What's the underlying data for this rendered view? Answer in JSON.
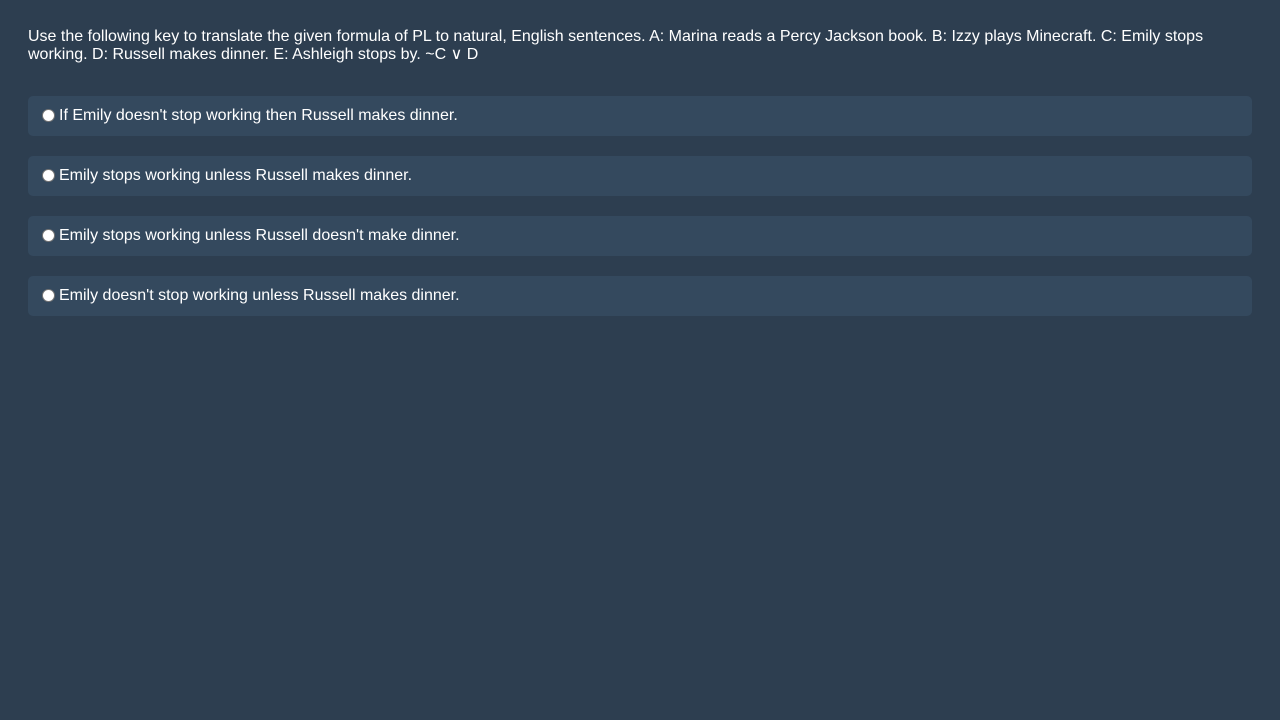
{
  "question": {
    "text": "Use the following key to translate the given formula of PL to natural, English sentences. A: Marina reads a Percy Jackson book. B: Izzy plays Minecraft. C: Emily stops working. D: Russell makes dinner. E: Ashleigh stops by. ~C ∨ D"
  },
  "options": [
    {
      "label": "If Emily doesn't stop working then Russell makes dinner."
    },
    {
      "label": "Emily stops working unless Russell makes dinner."
    },
    {
      "label": "Emily stops working unless Russell doesn't make dinner."
    },
    {
      "label": "Emily doesn't stop working unless Russell makes dinner."
    }
  ],
  "colors": {
    "background": "#2d3e50",
    "option_background": "#34495e",
    "text": "#ffffff"
  }
}
